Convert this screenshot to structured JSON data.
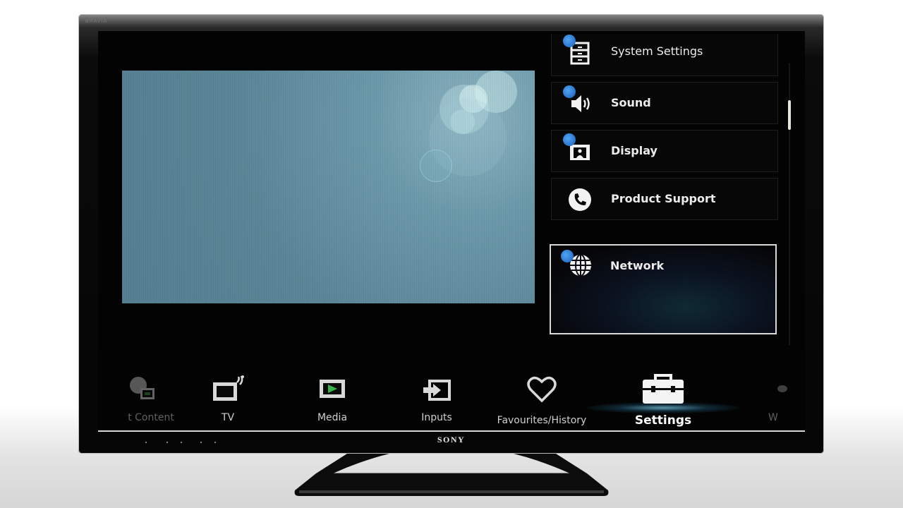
{
  "device": {
    "brand_top": "BRAVIA",
    "brand_bottom": "SONY"
  },
  "settings_menu": {
    "items": [
      {
        "label": "System Settings",
        "icon": "cabinet-icon",
        "has_wrench_badge": true
      },
      {
        "label": "Sound",
        "icon": "speaker-icon",
        "has_wrench_badge": true
      },
      {
        "label": "Display",
        "icon": "display-icon",
        "has_wrench_badge": true
      },
      {
        "label": "Product Support",
        "icon": "phone-icon",
        "has_wrench_badge": false
      },
      {
        "label": "Network",
        "icon": "globe-icon",
        "has_wrench_badge": true,
        "selected": true
      }
    ],
    "scroll_up_icon": "chevron-up-icon",
    "scroll_down_icon": "chevron-down-icon"
  },
  "xmb": {
    "items": [
      {
        "label": "t Content",
        "icon": "internet-content-icon"
      },
      {
        "label": "TV",
        "icon": "tv-icon"
      },
      {
        "label": "Media",
        "icon": "media-icon"
      },
      {
        "label": "Inputs",
        "icon": "inputs-icon"
      },
      {
        "label": "Favourites/History",
        "icon": "heart-icon"
      },
      {
        "label": "Settings",
        "icon": "toolbox-icon",
        "active": true
      },
      {
        "label": "W",
        "icon": "widgets-icon"
      }
    ]
  },
  "colors": {
    "wrench_badge": "#2f7fd8",
    "preview_bg": "#5b8698",
    "selection_border": "#d9d9d9",
    "active_glow": "#78c8e6"
  }
}
